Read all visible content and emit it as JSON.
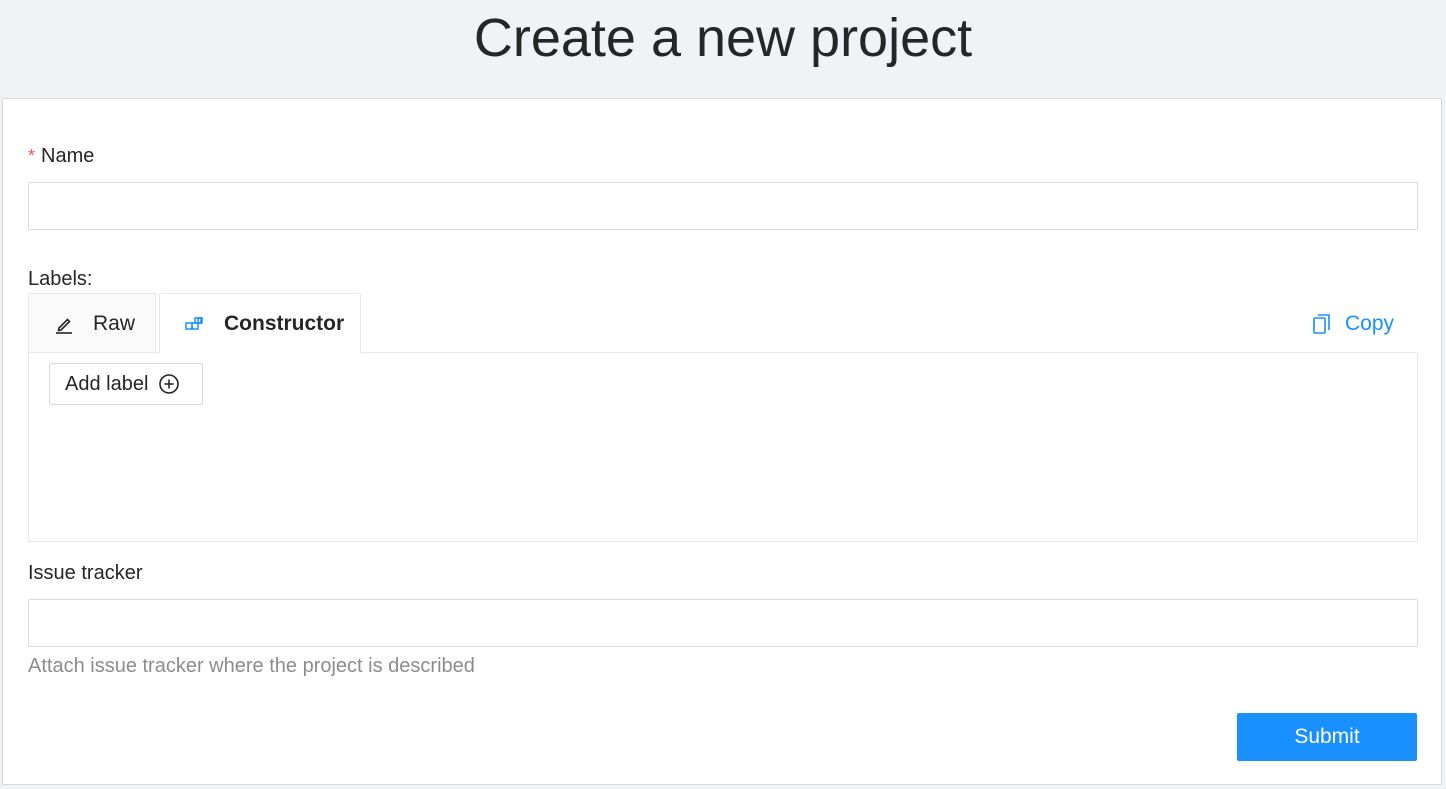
{
  "page": {
    "title": "Create a new project"
  },
  "form": {
    "name": {
      "required_mark": "*",
      "label": "Name",
      "value": "",
      "placeholder": ""
    },
    "labels": {
      "label": "Labels:",
      "tabs": [
        {
          "label": "Raw",
          "icon": "edit-icon",
          "active": false
        },
        {
          "label": "Constructor",
          "icon": "build-icon",
          "active": true
        }
      ],
      "copy_label": "Copy",
      "copy_icon": "copy-icon",
      "add_label_text": "Add label",
      "add_label_icon": "plus-circle-icon"
    },
    "issue_tracker": {
      "label": "Issue tracker",
      "value": "",
      "placeholder": "",
      "help": "Attach issue tracker where the project is described"
    },
    "submit_label": "Submit"
  },
  "colors": {
    "accent": "#1890ff",
    "required": "#ff4d4f",
    "background": "#f0f2f5"
  }
}
